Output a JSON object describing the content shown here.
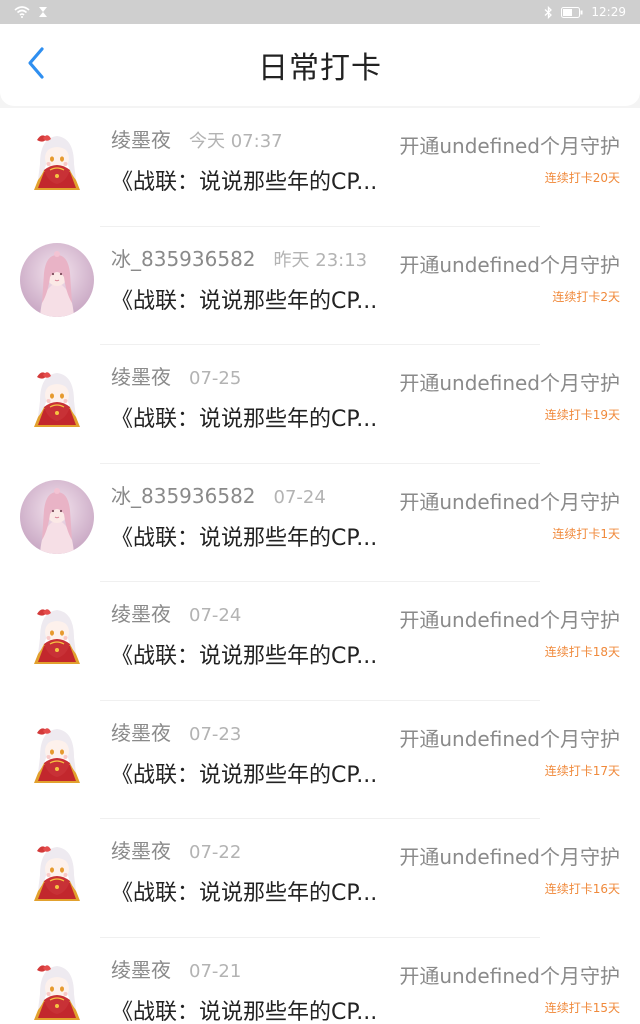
{
  "status_bar": {
    "time": "12:29"
  },
  "header": {
    "title": "日常打卡"
  },
  "colors": {
    "accent": "#2f8ff0",
    "streak": "#f08a3c",
    "muted": "#8a8a8a"
  },
  "entries": [
    {
      "user": "绫墨夜",
      "time": "今天 07:37",
      "content": "《战联：说说那些年的CP...",
      "guard": "开通undefined个月守护",
      "streak": "连续打卡20天",
      "avatar": "girl-red"
    },
    {
      "user": "冰_835936582",
      "time": "昨天 23:13",
      "content": "《战联：说说那些年的CP...",
      "guard": "开通undefined个月守护",
      "streak": "连续打卡2天",
      "avatar": "girl-pink"
    },
    {
      "user": "绫墨夜",
      "time": "07-25",
      "content": "《战联：说说那些年的CP...",
      "guard": "开通undefined个月守护",
      "streak": "连续打卡19天",
      "avatar": "girl-red"
    },
    {
      "user": "冰_835936582",
      "time": "07-24",
      "content": "《战联：说说那些年的CP...",
      "guard": "开通undefined个月守护",
      "streak": "连续打卡1天",
      "avatar": "girl-pink"
    },
    {
      "user": "绫墨夜",
      "time": "07-24",
      "content": "《战联：说说那些年的CP...",
      "guard": "开通undefined个月守护",
      "streak": "连续打卡18天",
      "avatar": "girl-red"
    },
    {
      "user": "绫墨夜",
      "time": "07-23",
      "content": "《战联：说说那些年的CP...",
      "guard": "开通undefined个月守护",
      "streak": "连续打卡17天",
      "avatar": "girl-red"
    },
    {
      "user": "绫墨夜",
      "time": "07-22",
      "content": "《战联：说说那些年的CP...",
      "guard": "开通undefined个月守护",
      "streak": "连续打卡16天",
      "avatar": "girl-red"
    },
    {
      "user": "绫墨夜",
      "time": "07-21",
      "content": "《战联：说说那些年的CP...",
      "guard": "开通undefined个月守护",
      "streak": "连续打卡15天",
      "avatar": "girl-red"
    }
  ]
}
